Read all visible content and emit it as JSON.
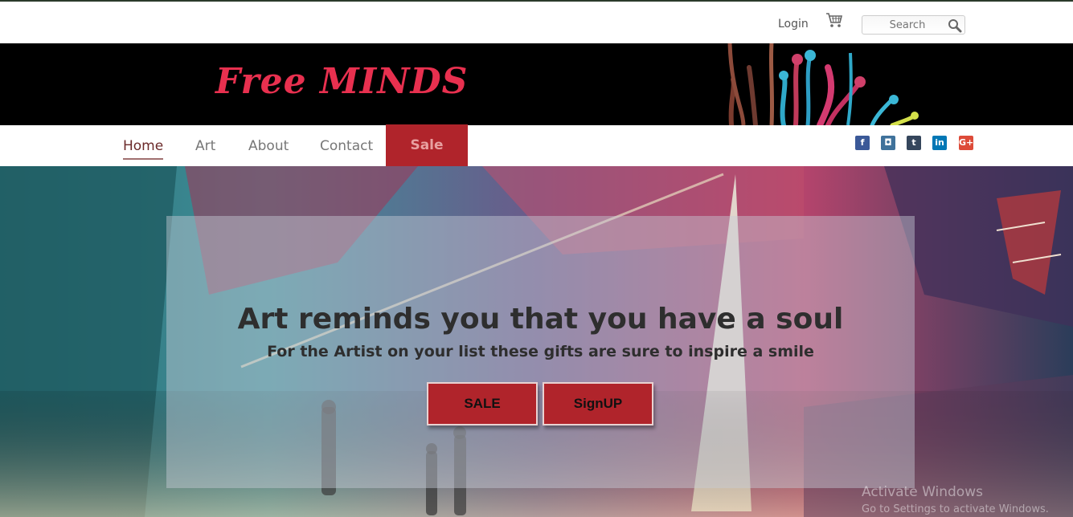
{
  "header": {
    "login_label": "Login",
    "search_placeholder": "Search"
  },
  "brand": {
    "logo_text": "Free MINDS"
  },
  "nav": {
    "items": [
      {
        "label": "Home"
      },
      {
        "label": "Art"
      },
      {
        "label": "About"
      },
      {
        "label": "Contact"
      },
      {
        "label": "Sale"
      }
    ],
    "social": [
      "facebook-icon",
      "instagram-icon",
      "tumblr-icon",
      "linkedin-icon",
      "google-plus-icon"
    ],
    "social_glyphs": [
      "f",
      "◘",
      "t",
      "in",
      "G+"
    ]
  },
  "hero": {
    "headline": "Art reminds you that you have a soul",
    "subheadline": "For the Artist on your list these gifts are sure to inspire a smile",
    "buttons": {
      "sale": "SALE",
      "signup": "SignUP"
    }
  },
  "watermark": {
    "title": "Activate Windows",
    "subtitle": "Go to Settings to activate Windows."
  },
  "colors": {
    "accent": "#b0242b",
    "logo": "#e8304f",
    "brand_band": "#000000"
  }
}
